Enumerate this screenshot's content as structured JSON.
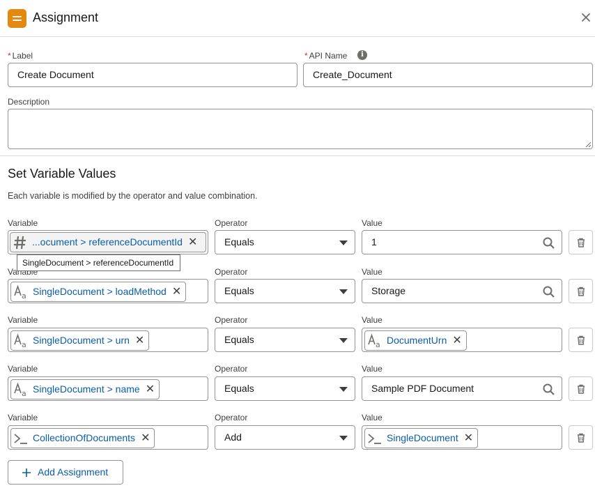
{
  "header": {
    "title": "Assignment",
    "icon": "assignment-icon",
    "accent": "#e4890f"
  },
  "form": {
    "label_label": "Label",
    "label_value": "Create Document",
    "api_name_label": "API Name",
    "api_name_value": "Create_Document",
    "description_label": "Description",
    "description_value": ""
  },
  "section": {
    "title": "Set Variable Values",
    "help": "Each variable is modified by the operator and value combination."
  },
  "column_labels": {
    "variable": "Variable",
    "operator": "Operator",
    "value": "Value"
  },
  "rows": [
    {
      "variable": "...ocument > referenceDocumentId",
      "variable_icon": "number-icon",
      "operator": "Equals",
      "value": "1",
      "value_kind": "text"
    },
    {
      "variable": "SingleDocument > loadMethod",
      "variable_icon": "text-icon",
      "operator": "Equals",
      "value": "Storage",
      "value_kind": "text"
    },
    {
      "variable": "SingleDocument > urn",
      "variable_icon": "text-icon",
      "operator": "Equals",
      "value": "DocumentUrn",
      "value_kind": "pill",
      "value_icon": "text-icon"
    },
    {
      "variable": "SingleDocument > name",
      "variable_icon": "text-icon",
      "operator": "Equals",
      "value": "Sample PDF Document",
      "value_kind": "text"
    },
    {
      "variable": "CollectionOfDocuments",
      "variable_icon": "collection-icon",
      "operator": "Add",
      "value": "SingleDocument",
      "value_kind": "pill",
      "value_icon": "collection-icon"
    }
  ],
  "tooltip": "SingleDocument > referenceDocumentId",
  "add_button": "Add Assignment",
  "colors": {
    "link": "#0b5cab",
    "required": "#c23934",
    "border": "#939393"
  }
}
